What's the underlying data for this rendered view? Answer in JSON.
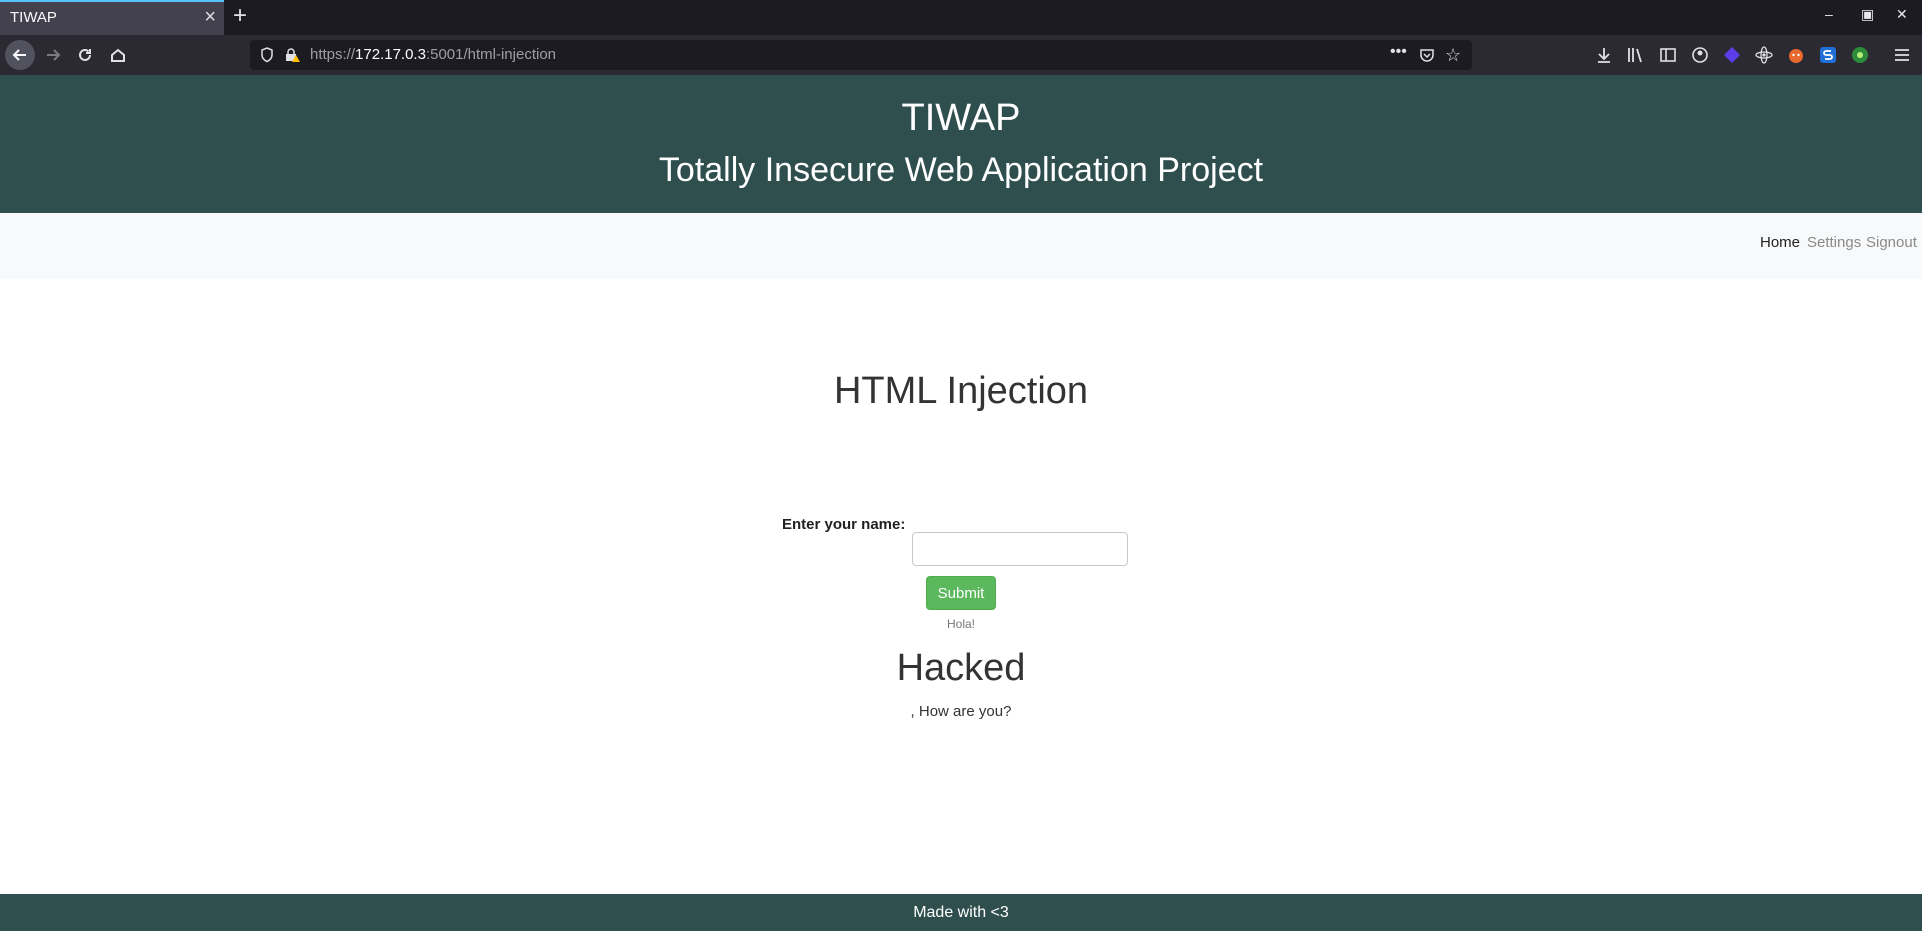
{
  "browser": {
    "tab_title": "TIWAP",
    "url_prefix": "https://",
    "url_host": "172.17.0.3",
    "url_path": ":5001/html-injection"
  },
  "header": {
    "title": "TIWAP",
    "subtitle": "Totally Insecure Web Application Project"
  },
  "nav": {
    "home": "Home",
    "settings": "Settings",
    "signout": "Signout"
  },
  "main": {
    "heading": "HTML Injection",
    "name_label": "Enter your name:",
    "name_value": "",
    "submit_label": "Submit",
    "greeting": "Hola!",
    "injected_heading": "Hacked",
    "followup": ", How are you?"
  },
  "footer": {
    "text": "Made with <3"
  },
  "colors": {
    "header_bg": "#2f4f4f",
    "nav_bg": "#f8f9fa",
    "submit_bg": "#5cb85c"
  }
}
